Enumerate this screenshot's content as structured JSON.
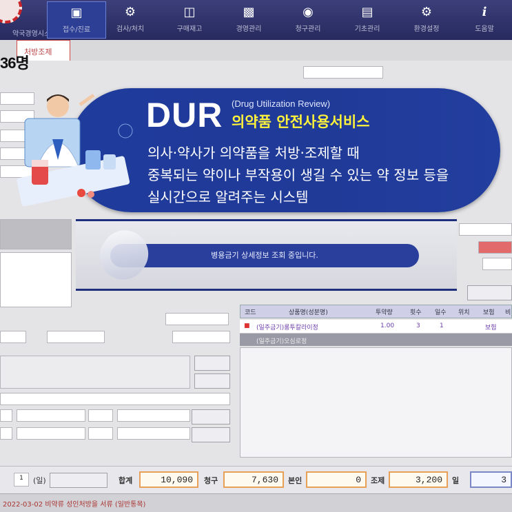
{
  "toolbar": {
    "items": [
      {
        "label": "접수/진료",
        "icon": "camera-icon"
      },
      {
        "label": "검사/처치",
        "icon": "medicine-icon"
      },
      {
        "label": "구매재고",
        "icon": "pill-icon"
      },
      {
        "label": "경영관리",
        "icon": "chart-icon"
      },
      {
        "label": "청구관리",
        "icon": "money-icon"
      },
      {
        "label": "기초관리",
        "icon": "clipboard-icon"
      },
      {
        "label": "환경설정",
        "icon": "gear-icon"
      },
      {
        "label": "도움말",
        "icon": "info-icon"
      }
    ],
    "logo_sub": "약국경영시스템"
  },
  "patient": {
    "count": "36명",
    "tab_label": "처방조제"
  },
  "dur": {
    "title": "DUR",
    "english": "(Drug Utilization Review)",
    "subtitle": "의약품 안전사용서비스",
    "desc_line1": "의사·약사가 의약품을 처방·조제할 때",
    "desc_line2": "중복되는 약이나 부작용이 생길 수 있는 약 정보 등을",
    "desc_line3": "실시간으로 알려주는 시스템"
  },
  "loading": {
    "message": "병용금기 상세정보 조회 중입니다."
  },
  "drug_table": {
    "columns": [
      "코드",
      "상품명(성분명)",
      "투약량",
      "횟수",
      "일수",
      "위치",
      "보험",
      "비"
    ],
    "rows": [
      {
        "name": "(일주금기)롱투칼라이정",
        "dose": "1.00",
        "times": "3",
        "days": "1",
        "ins": "보험"
      },
      {
        "name": "(일주금기)오심로정",
        "dose": "",
        "times": "",
        "days": "",
        "ins": ""
      }
    ]
  },
  "totals": {
    "qty_label": "(일)",
    "qty_value": "1",
    "total_label": "합계",
    "total_value": "10,090",
    "claim_label": "청구",
    "claim_value": "7,630",
    "copay_label": "본인",
    "copay_value": "0",
    "self_label": "조제",
    "self_value": "3,200",
    "extra_label": "일",
    "extra_value": "3"
  },
  "status": {
    "text": "2022-03-02  비약류 성인처방을 서류 (일반통목)"
  },
  "colors": {
    "banner": "#203a98",
    "banner_subtitle": "#fff23b",
    "toolbar": "#2c2f6a",
    "total_border": "#e8a058"
  }
}
